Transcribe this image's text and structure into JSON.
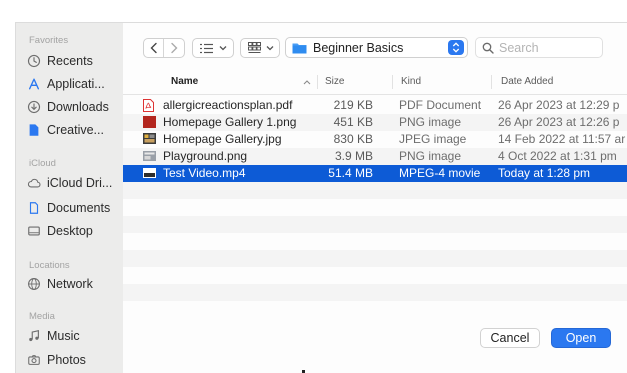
{
  "sidebar": {
    "sections": [
      {
        "heading": "Favorites",
        "items": [
          {
            "label": "Recents",
            "icon": "clock-icon"
          },
          {
            "label": "Applicati...",
            "icon": "applications-icon"
          },
          {
            "label": "Downloads",
            "icon": "download-icon"
          },
          {
            "label": "Creative...",
            "icon": "folder-icon"
          }
        ]
      },
      {
        "heading": "iCloud",
        "items": [
          {
            "label": "iCloud Dri...",
            "icon": "cloud-icon"
          },
          {
            "label": "Documents",
            "icon": "document-icon"
          },
          {
            "label": "Desktop",
            "icon": "desktop-icon"
          }
        ]
      },
      {
        "heading": "Locations",
        "items": [
          {
            "label": "Network",
            "icon": "globe-icon"
          }
        ]
      },
      {
        "heading": "Media",
        "items": [
          {
            "label": "Music",
            "icon": "music-note-icon"
          },
          {
            "label": "Photos",
            "icon": "camera-icon"
          }
        ]
      }
    ]
  },
  "toolbar": {
    "path_label": "Beginner Basics",
    "search_placeholder": "Search"
  },
  "columns": {
    "name": "Name",
    "size": "Size",
    "kind": "Kind",
    "date_added": "Date Added"
  },
  "files": [
    {
      "name": "allergicreactionsplan.pdf",
      "size": "219 KB",
      "kind": "PDF Document",
      "date": "26 Apr 2023 at 12:29 p",
      "icon": "pdf-file-icon",
      "selected": false
    },
    {
      "name": "Homepage Gallery 1.png",
      "size": "451 KB",
      "kind": "PNG image",
      "date": "26 Apr 2023 at 12:26 p",
      "icon": "image-file-icon",
      "selected": false
    },
    {
      "name": "Homepage Gallery.jpg",
      "size": "830 KB",
      "kind": "JPEG image",
      "date": "14 Feb 2022 at 11:57 ar",
      "icon": "image-file-icon",
      "selected": false
    },
    {
      "name": "Playground.png",
      "size": "3.9 MB",
      "kind": "PNG image",
      "date": "4 Oct 2022 at 1:31 pm",
      "icon": "image-file-icon",
      "selected": false
    },
    {
      "name": "Test Video.mp4",
      "size": "51.4 MB",
      "kind": "MPEG-4 movie",
      "date": "Today at 1:28 pm",
      "icon": "video-file-icon",
      "selected": true
    }
  ],
  "buttons": {
    "cancel": "Cancel",
    "open": "Open"
  },
  "colors": {
    "accent": "#2b78f0",
    "selection": "#0d5bd6",
    "sidebar_bg": "#ececeb"
  }
}
